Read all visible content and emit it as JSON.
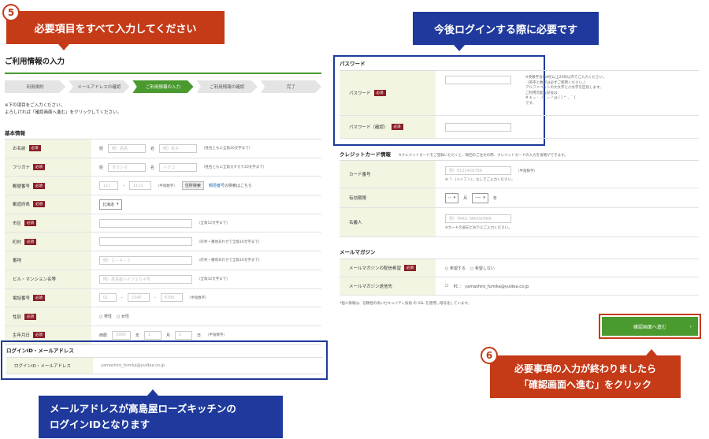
{
  "callouts": {
    "c5_num": "5",
    "c5_text": "必要項目をすべて入力してください",
    "login_text": "今後ログインする際に必要です",
    "email_text_1": "メールアドレスが高島屋ローズキッチンの",
    "email_text_2": "ログインIDとなります",
    "c6_num": "6",
    "c6_text_1": "必要事項の入力が終わりましたら",
    "c6_text_2": "「確認画面へ進む」をクリック"
  },
  "page": {
    "title": "ご利用情報の入力",
    "steps": [
      "利用規約",
      "メールアドレスの確認",
      "ご利用情報の入力",
      "ご利用情報の確認",
      "完了"
    ],
    "intro_1": "※下の項目をご入力ください。",
    "intro_2": "よろしければ「確認画面へ進む」をクリックしてください。",
    "basic_heading": "基本情報",
    "required": "必須"
  },
  "basic": {
    "name_label": "お名前",
    "sei": "姓",
    "mei": "名",
    "name_ph1": "例）高島",
    "name_ph2": "例）花子",
    "name_note": "（姓名ともに全角20文字まで）",
    "kana_label": "フリガナ",
    "kana_ph1": "タカシマ",
    "kana_ph2": "ハナコ",
    "kana_note": "（姓名ともに全角カタカナ20文字まで）",
    "zip_label": "郵便番号",
    "zip_ph1": "111",
    "zip_ph2": "1111",
    "zip_note": "（半角数字）",
    "zip_btn": "住所検索",
    "zip_link": "郵便番号",
    "zip_link_after": "の検索はこちら",
    "pref_label": "都道府県",
    "pref_value": "北海道",
    "city_label": "市区",
    "city_note": "（全角12文字まで）",
    "town_label": "町村",
    "town_note": "（町村・番地あわせて全角16文字まで）",
    "addr_label": "番地",
    "addr_ph": "例）２－４－３",
    "addr_note": "（町村・番地あわせて全角16文字まで）",
    "bldg_label": "ビル・マンション名等",
    "bldg_ph": "例）高島屋ハイツ２０４号",
    "bldg_note": "（全角32文字まで）",
    "tel_label": "電話番号",
    "tel_ph1": "01",
    "tel_ph2": "2345",
    "tel_ph3": "6789",
    "tel_note": "（半角数字）",
    "sex_label": "性別",
    "sex_m": "男性",
    "sex_f": "女性",
    "birth_label": "生年月日",
    "era": "西暦",
    "year_ph": "2000",
    "year": "年",
    "month_ph": "1",
    "month": "月",
    "day_ph": "1",
    "day": "日",
    "birth_note": "（半角数字）"
  },
  "login": {
    "heading": "ログインID・メールアドレス",
    "label": "ログインID・メールアドレス",
    "value": "yamashiro_fumika@yuidea.co.jp"
  },
  "password": {
    "heading": "パスワード",
    "pw_label": "パスワード",
    "pw_confirm_label": "パスワード（確認）",
    "note_1": "※英数字含め8桁以上20桁以内でご入力ください。",
    "note_2": "（英字と数字は必ずご使用ください。）",
    "note_3": "アルファベットの大文字と小文字を区別します。",
    "note_4": "ご利用可能な記号は",
    "note_5": "# $ = - . / _ = ? @ [ ] ^ _ ` {",
    "note_6": "です。"
  },
  "card": {
    "heading": "クレジットカード情報",
    "heading_note": "※クレジットカードをご登録いただくと、毎回のご注文の際、クレジットカードの入力を省略ができます。",
    "num_label": "カード番号",
    "num_ph": "例）0123456789",
    "num_note": "（半角数字）",
    "num_note2": "※「-（ハイフン）」なしでご入力ください。",
    "exp_label": "有効期限",
    "exp_month": "--",
    "exp_m": "月",
    "exp_year": "----",
    "exp_y": "年",
    "name_label": "名義人",
    "name_ph": "例）TARO TAKASHIMA",
    "name_note": "※カードの表記どおりにご入力ください。"
  },
  "magazine": {
    "heading": "メールマガジン",
    "pref_label": "メールマガジンの配信希望",
    "opt_yes": "希望する",
    "opt_no": "希望しない",
    "dest_label": "メールマガジン送信先",
    "dest_value": "PC ： yamashiro_fumika@yuidea.co.jp"
  },
  "footer": {
    "ssl_note": "*個人情報は、信頼性の高いセキュリティ技術 の SSL を使用し暗号化しています。",
    "confirm_button": "確認画面へ進む",
    "arrow": "›"
  }
}
